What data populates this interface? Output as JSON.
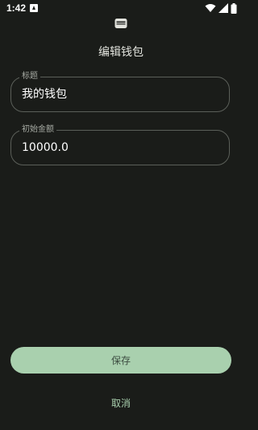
{
  "status_bar": {
    "time": "1:42",
    "notification_icon": "text-a-icon",
    "wifi_icon": "wifi-icon",
    "signal_icon": "signal-icon",
    "battery_icon": "battery-icon"
  },
  "header": {
    "icon": "wallet-icon",
    "title": "编辑钱包"
  },
  "form": {
    "title_field": {
      "label": "标题",
      "value": "我的钱包"
    },
    "amount_field": {
      "label": "初始金额",
      "value": "10000.0"
    }
  },
  "actions": {
    "save_label": "保存",
    "cancel_label": "取消"
  },
  "colors": {
    "background": "#1a1c19",
    "primary_button": "#a9d0ae",
    "accent_text": "#a9d0ae",
    "outline": "#5b5f59"
  }
}
